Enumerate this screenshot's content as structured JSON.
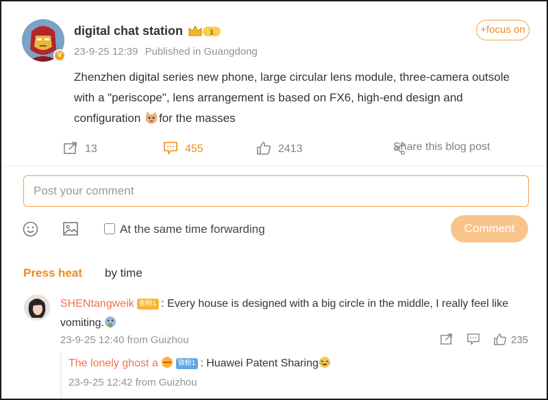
{
  "post": {
    "author": "digital chat station",
    "level_badge": "1",
    "timestamp": "23-9-25 12:39",
    "location": "Published in Guangdong",
    "follow_label": "+focus on",
    "text_main": "Zhenzhen digital series new phone, large circular lens module, three-camera outsole with a \"periscope\", lens arrangement is based on FX6, high-end design and configuration",
    "text_tail": "for the masses"
  },
  "actions": {
    "forward_count": "13",
    "comment_count": "455",
    "like_count": "2413",
    "share_label": "Share this blog post"
  },
  "composer": {
    "placeholder": "Post your comment",
    "forward_label": "At the same time forwarding",
    "submit_label": "Comment"
  },
  "sort": {
    "heat_label": "Press heat",
    "time_label": "by time"
  },
  "comments": [
    {
      "user": "SHENtangweik",
      "badge": "金粉1",
      "text": ": Every house is designed with a big circle in the middle, I really feel like vomiting.",
      "timestamp": "23-9-25 12:40 from Guizhou",
      "like_count": "235",
      "reply": {
        "user": "The lonely ghost a",
        "badge": "铁粉1",
        "text": ": Huawei Patent Sharing",
        "timestamp": "23-9-25 12:42 from Guizhou"
      }
    }
  ],
  "colors": {
    "accent": "#f2891a",
    "username": "#eb7350",
    "muted": "#939393",
    "button_disabled": "#f9c48b"
  }
}
